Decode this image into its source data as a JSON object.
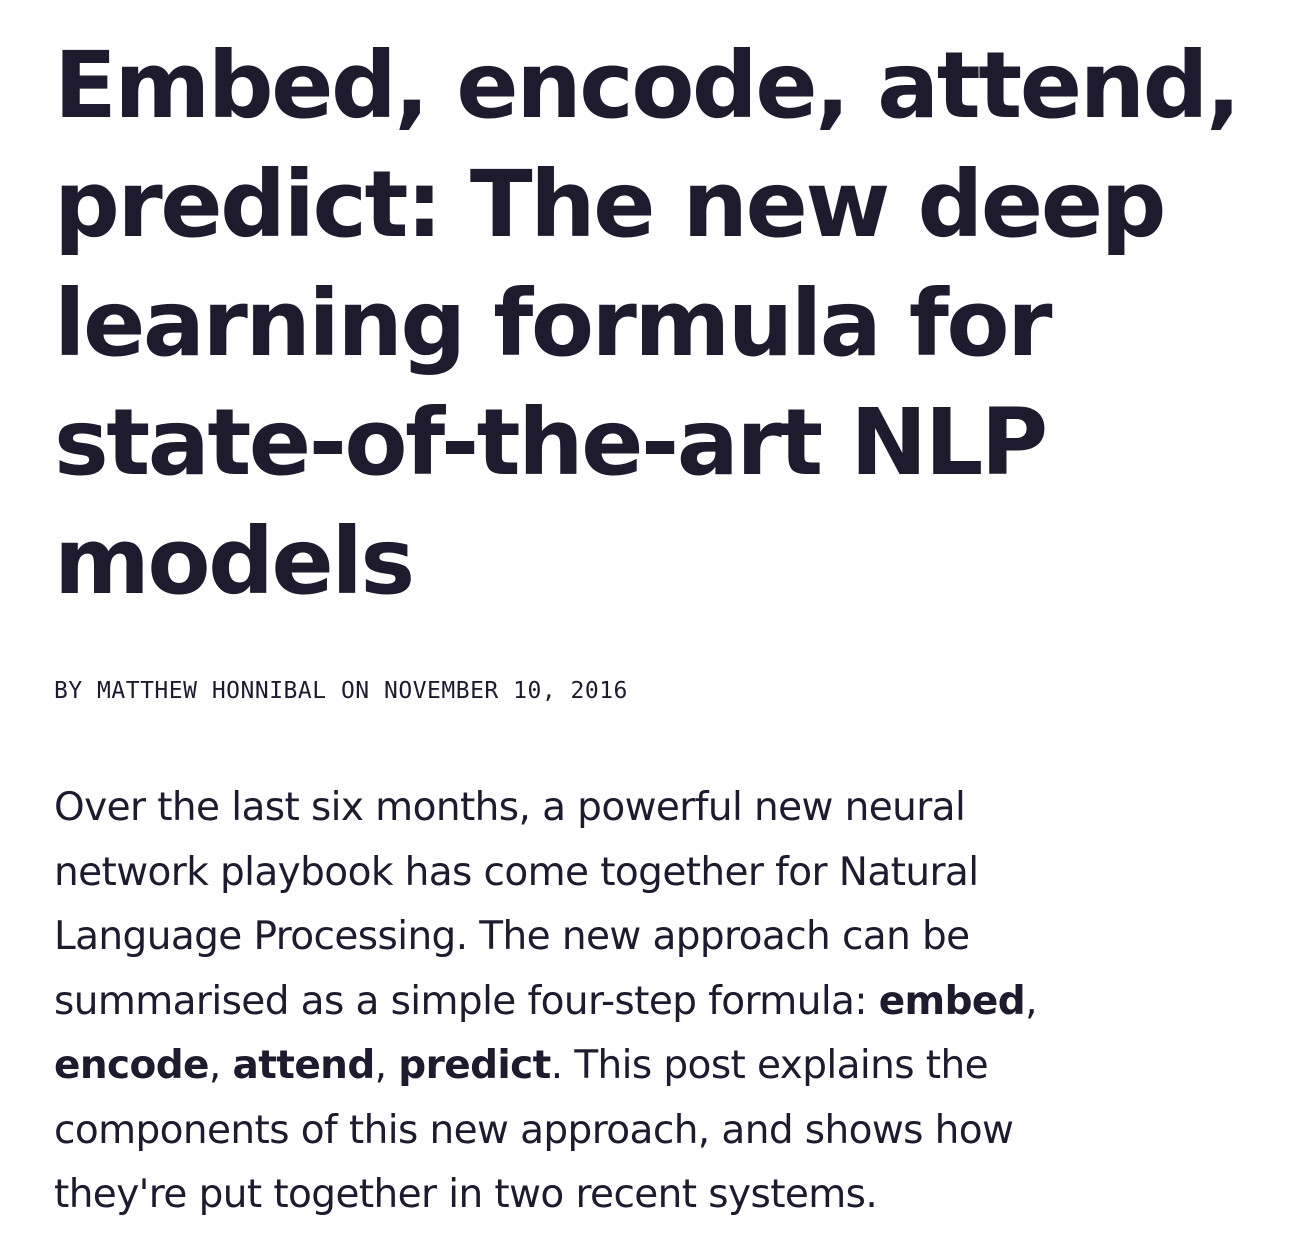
{
  "article": {
    "title_lines": [
      "Embed, encode, attend,",
      "predict: The new deep",
      "learning formula for",
      "state-of-the-art NLP",
      "models"
    ],
    "byline": {
      "prefix": "BY ",
      "author": "MATTHEW HONNIBAL",
      "middle": " ON ",
      "date": "NOVEMBER 10, 2016"
    },
    "intro": {
      "line1": "Over the last six months, a powerful new neural",
      "line2": "network playbook has come together for Natural",
      "line3": "Language Processing. The new approach can be",
      "line4_text": "summarised as a simple four-step formula: ",
      "line4_bold": "embed",
      "line4_end": ",",
      "line5_bold1": "encode",
      "sep1": ", ",
      "line5_bold2": "attend",
      "sep2": ", ",
      "line5_bold3": "predict",
      "line5_text": ". This post explains the",
      "line6": "components of this new approach, and shows how",
      "line7": "they're put together in two recent systems."
    }
  }
}
